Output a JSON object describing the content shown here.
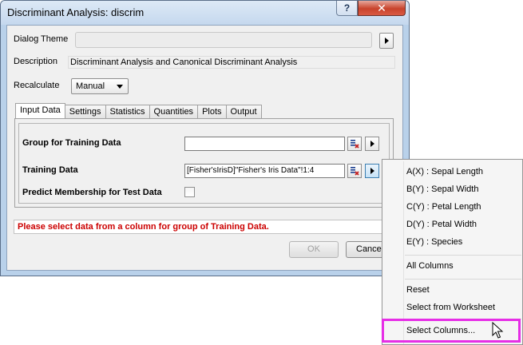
{
  "window": {
    "title": "Discriminant Analysis: discrim",
    "help_label": "?",
    "close_label": "✕"
  },
  "dialog_theme": {
    "label": "Dialog Theme",
    "value": ""
  },
  "description": {
    "label": "Description",
    "value": "Discriminant Analysis and Canonical Discriminant Analysis"
  },
  "recalculate": {
    "label": "Recalculate",
    "value": "Manual"
  },
  "tabs": [
    {
      "label": "Input Data"
    },
    {
      "label": "Settings"
    },
    {
      "label": "Statistics"
    },
    {
      "label": "Quantities"
    },
    {
      "label": "Plots"
    },
    {
      "label": "Output"
    }
  ],
  "form": {
    "group_label": "Group for Training Data",
    "group_value": "",
    "training_label": "Training Data",
    "training_value": "[Fisher'sIrisD]\"Fisher's Iris Data\"!1:4",
    "predict_label": "Predict Membership for Test Data",
    "predict_checked": false
  },
  "error_message": "Please select data from a column for group of Training Data.",
  "buttons": {
    "ok": "OK",
    "cancel": "Cance"
  },
  "context_menu": {
    "columns": [
      "A(X) : Sepal Length",
      "B(Y) : Sepal Width",
      "C(Y) : Petal Length",
      "D(Y) : Petal Width",
      "E(Y) : Species"
    ],
    "all_columns": "All Columns",
    "reset": "Reset",
    "select_from_worksheet": "Select from Worksheet",
    "select_columns": "Select Columns..."
  },
  "colors": {
    "error_text": "#cc0000",
    "highlight_border": "#e62ee6",
    "frame": "#b9d1ea"
  }
}
